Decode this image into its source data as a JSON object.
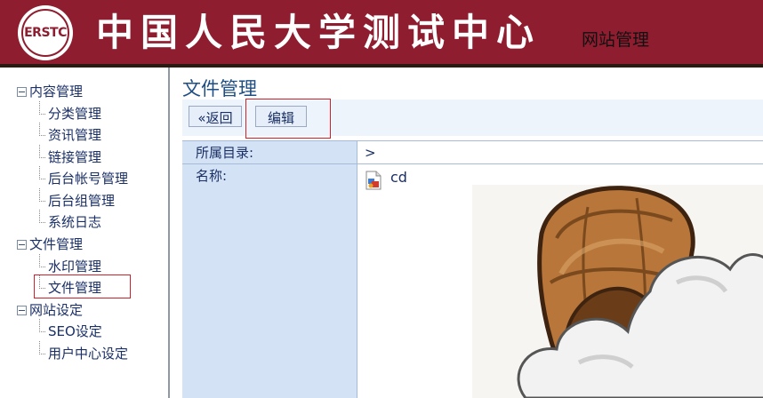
{
  "header": {
    "logo_text": "ERSTC",
    "title": "中国人民大学测试中心",
    "subtitle": "网站管理"
  },
  "sidebar": {
    "groups": [
      {
        "label": "内容管理",
        "items": [
          "分类管理",
          "资讯管理",
          "链接管理",
          "后台帐号管理",
          "后台组管理",
          "系统日志"
        ]
      },
      {
        "label": "文件管理",
        "items": [
          "水印管理",
          "文件管理"
        ]
      },
      {
        "label": "网站设定",
        "items": [
          "SEO设定",
          "用户中心设定"
        ]
      }
    ],
    "selected": "文件管理"
  },
  "main": {
    "title": "文件管理",
    "toolbar": {
      "back_label": "«返回",
      "edit_label": "编辑"
    },
    "fields": {
      "directory_label": "所属目录:",
      "directory_value": ">",
      "name_label": "名称:",
      "name_value": "cd"
    }
  },
  "colors": {
    "header_bg": "#8f1d30",
    "label_col": "#d3e2f4",
    "link": "#1a2f66"
  }
}
